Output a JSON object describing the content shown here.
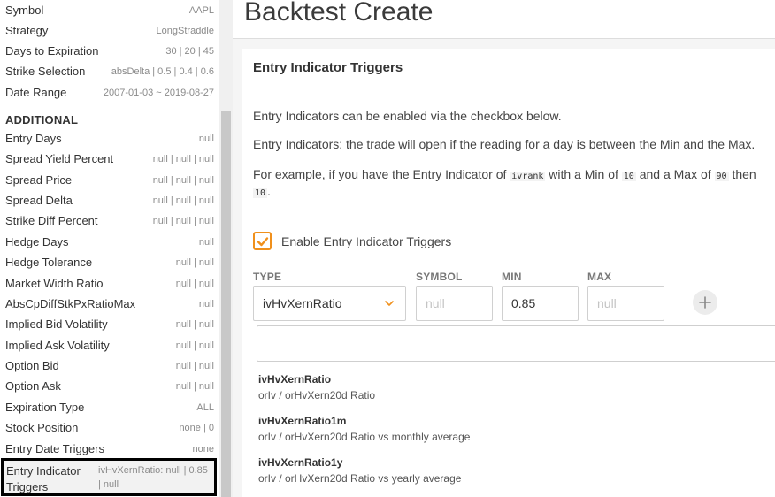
{
  "sidebar": {
    "rows": [
      {
        "label": "Symbol",
        "value": "AAPL"
      },
      {
        "label": "Strategy",
        "value": "LongStraddle"
      },
      {
        "label": "Days to Expiration",
        "value": "30 | 20 | 45"
      },
      {
        "label": "Strike Selection",
        "value": "absDelta | 0.5 | 0.4 | 0.6"
      },
      {
        "label": "Date Range",
        "value": "2007-01-03 ~ 2019-08-27"
      }
    ],
    "additional_heading": "ADDITIONAL",
    "additional": [
      {
        "label": "Entry Days",
        "value": "null"
      },
      {
        "label": "Spread Yield Percent",
        "value": "null | null | null"
      },
      {
        "label": "Spread Price",
        "value": "null | null | null"
      },
      {
        "label": "Spread Delta",
        "value": "null | null | null"
      },
      {
        "label": "Strike Diff Percent",
        "value": "null | null | null"
      },
      {
        "label": "Hedge Days",
        "value": "null"
      },
      {
        "label": "Hedge Tolerance",
        "value": "null | null"
      },
      {
        "label": "Market Width Ratio",
        "value": "null | null"
      },
      {
        "label": "AbsCpDiffStkPxRatioMax",
        "value": "null"
      },
      {
        "label": "Implied Bid Volatility",
        "value": "null | null"
      },
      {
        "label": "Implied Ask Volatility",
        "value": "null | null"
      },
      {
        "label": "Option Bid",
        "value": "null | null"
      },
      {
        "label": "Option Ask",
        "value": "null | null"
      },
      {
        "label": "Expiration Type",
        "value": "ALL"
      },
      {
        "label": "Stock Position",
        "value": "none | 0"
      },
      {
        "label": "Entry Date Triggers",
        "value": "none"
      }
    ],
    "selected": {
      "label": "Entry Indicator Triggers",
      "value": "ivHvXernRatio: null | 0.85 | null"
    }
  },
  "header": {
    "title": "Backtest Create"
  },
  "card": {
    "title": "Entry Indicator Triggers",
    "para1": "Entry Indicators can be enabled via the checkbox below.",
    "para2": "Entry Indicators: the trade will open if the reading for a day is between the Min and the Max.",
    "para3_a": "For example, if you have the Entry Indicator of ",
    "para3_code1": "ivrank",
    "para3_b": " with a Min of ",
    "para3_code2": "10",
    "para3_c": " and a Max of ",
    "para3_code3": "90",
    "para3_d": " then",
    "para3_code4": "10",
    "para3_e": ".",
    "checkbox_label": "Enable Entry Indicator Triggers",
    "checkbox_checked": true
  },
  "fields": {
    "type_label": "TYPE",
    "type_value": "ivHvXernRatio",
    "symbol_label": "SYMBOL",
    "symbol_placeholder": "null",
    "min_label": "MIN",
    "min_value": "0.85",
    "max_label": "MAX",
    "max_placeholder": "null"
  },
  "dropdown": {
    "search_value": "",
    "options": [
      {
        "title": "ivHvXernRatio",
        "desc": "orIv / orHvXern20d Ratio"
      },
      {
        "title": "ivHvXernRatio1m",
        "desc": "orIv / orHvXern20d Ratio vs monthly average"
      },
      {
        "title": "ivHvXernRatio1y",
        "desc": "orIv / orHvXern20d Ratio vs yearly average"
      }
    ]
  },
  "colors": {
    "accent": "#f0901c"
  }
}
